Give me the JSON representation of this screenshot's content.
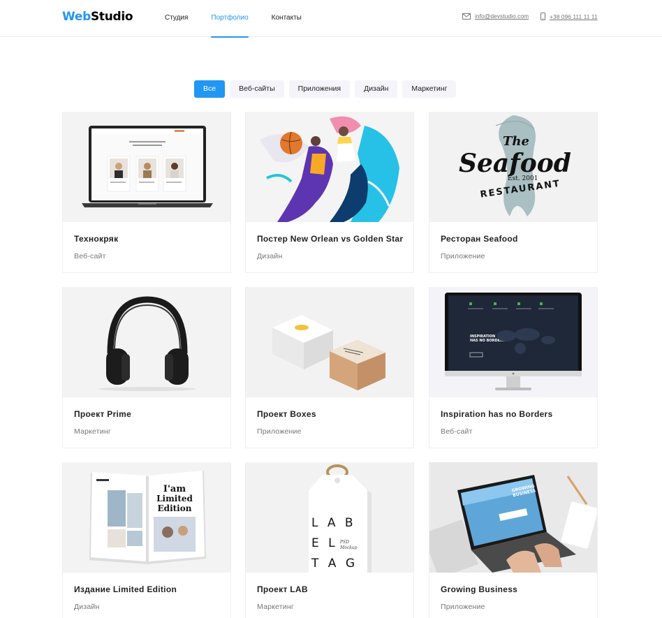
{
  "header": {
    "logo_part1": "Web",
    "logo_part2": "Studio",
    "nav": [
      {
        "label": "Студия",
        "active": false
      },
      {
        "label": "Портфолио",
        "active": true
      },
      {
        "label": "Контакты",
        "active": false
      }
    ],
    "email": "info@devstudio.com",
    "phone": "+38 096 111 11 11",
    "email_icon": "envelope-icon",
    "phone_icon": "smartphone-icon"
  },
  "filters": [
    {
      "label": "Все",
      "active": true
    },
    {
      "label": "Веб-сайты",
      "active": false
    },
    {
      "label": "Приложения",
      "active": false
    },
    {
      "label": "Дизайн",
      "active": false
    },
    {
      "label": "Маркетинг",
      "active": false
    }
  ],
  "projects": [
    {
      "title": "Технокряк",
      "category": "Веб-сайт",
      "image": "laptop-mockup"
    },
    {
      "title": "Постер New Orlean vs Golden Star",
      "category": "Дизайн",
      "image": "basketball-poster"
    },
    {
      "title": "Ресторан Seafood",
      "category": "Приложение",
      "image": "seafood-logo"
    },
    {
      "title": "Проект Prime",
      "category": "Маркетинг",
      "image": "headphones"
    },
    {
      "title": "Проект Boxes",
      "category": "Приложение",
      "image": "boxes-mockup"
    },
    {
      "title": "Inspiration has no Borders",
      "category": "Веб-сайт",
      "image": "monitor-mockup"
    },
    {
      "title": "Издание Limited Edition",
      "category": "Дизайн",
      "image": "magazine-mockup"
    },
    {
      "title": "Проект LAB",
      "category": "Маркетинг",
      "image": "label-tag-mockup"
    },
    {
      "title": "Growing Business",
      "category": "Приложение",
      "image": "laptop-on-desk"
    }
  ],
  "image_text": {
    "seafood_the": "The",
    "seafood_main": "Seafood",
    "seafood_est": "Est. 2001",
    "seafood_restaurant": "RESTAURANT",
    "magazine_headline": [
      "I'am",
      "Limited",
      "Edition"
    ],
    "tag_lines": [
      "L A B",
      "E L",
      "T A G"
    ],
    "tag_small": [
      "PSD",
      "Mockup"
    ],
    "growing_lines": [
      "GROWING",
      "BUSINESS"
    ],
    "monitor_headline": [
      "INSPIRATION",
      "HAS NO BORDERS"
    ]
  },
  "colors": {
    "accent": "#2196f3",
    "text": "#212121",
    "muted": "#757575",
    "filter_bg": "#f5f4fa"
  }
}
